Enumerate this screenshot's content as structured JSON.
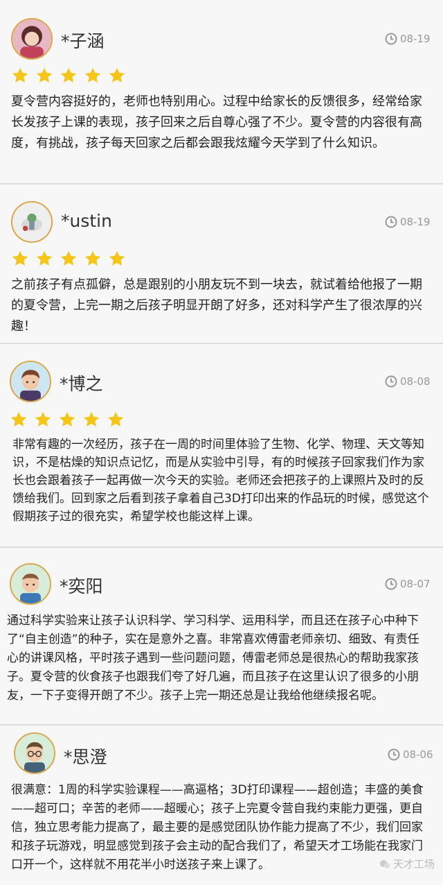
{
  "reviews": [
    {
      "name": "*子涵",
      "date": "08-19",
      "rating": 5,
      "avatar": "girl-photo-avatar",
      "text": "夏令营内容挺好的，老师也特别用心。过程中给家长的反馈很多，经常给家长发孩子上课的表现，孩子回来之后自尊心强了不少。夏令营的内容很有高度，有挑战，孩子每天回家之后都会跟我炫耀今天学到了什么知识。"
    },
    {
      "name": "*ustin",
      "date": "08-19",
      "rating": 5,
      "avatar": "toy-photo-avatar",
      "text": "之前孩子有点孤僻，总是跟别的小朋友玩不到一块去，就试着给他报了一期的夏令营，上完一期之后孩子明显开朗了好多，还对科学产生了很浓厚的兴趣！"
    },
    {
      "name": "*博之",
      "date": "08-08",
      "rating": 5,
      "avatar": "cartoon-boy-avatar",
      "text": "非常有趣的一次经历，孩子在一周的时间里体验了生物、化学、物理、天文等知识，不是枯燥的知识点记忆，而是从实验中引导，有的时候孩子回家我们作为家长也会跟着孩子一起再做一次今天的实验。老师还会把孩子的上课照片及时的反馈给我们。回到家之后看到孩子拿着自己3D打印出来的作品玩的时候，感觉这个假期孩子过的很充实，希望学校也能这样上课。"
    },
    {
      "name": "*奕阳",
      "date": "08-07",
      "rating": 0,
      "avatar": "cartoon-man-avatar",
      "text": "通过科学实验来让孩子认识科学、学习科学、运用科学，而且还在孩子心中种下了“自主创造”的种子，实在是意外之喜。非常喜欢傅雷老师亲切、细致、有责任心的讲课风格，平时孩子遇到一些问题问题，傅雷老师总是很热心的帮助我家孩子。夏令营的伙食孩子也跟我们夸了好几遍，而且孩子在这里认识了很多的小朋友，一下子变得开朗了不少。孩子上完一期还总是让我给他继续报名呢。"
    },
    {
      "name": "*思澄",
      "date": "08-06",
      "rating": 0,
      "avatar": "cartoon-glasses-avatar",
      "text": "很满意：1周的科学实验课程——高逼格；3D打印课程——超创造；丰盛的美食——超可口；辛苦的老师——超暖心；孩子上完夏令营自我约束能力更强，更自信，独立思考能力提高了，最主要的是感觉团队协作能力提高了不少，我们回家和孩子玩游戏，明显感觉到孩子会主动的配合我们了，希望天才工场能在我家门口开一个，这样就不用花半小时送孩子来上课了。"
    }
  ],
  "watermark": "天才工场",
  "colors": {
    "star": "#f5c518",
    "avatar_border": "#d9a64a",
    "date": "#999999"
  }
}
